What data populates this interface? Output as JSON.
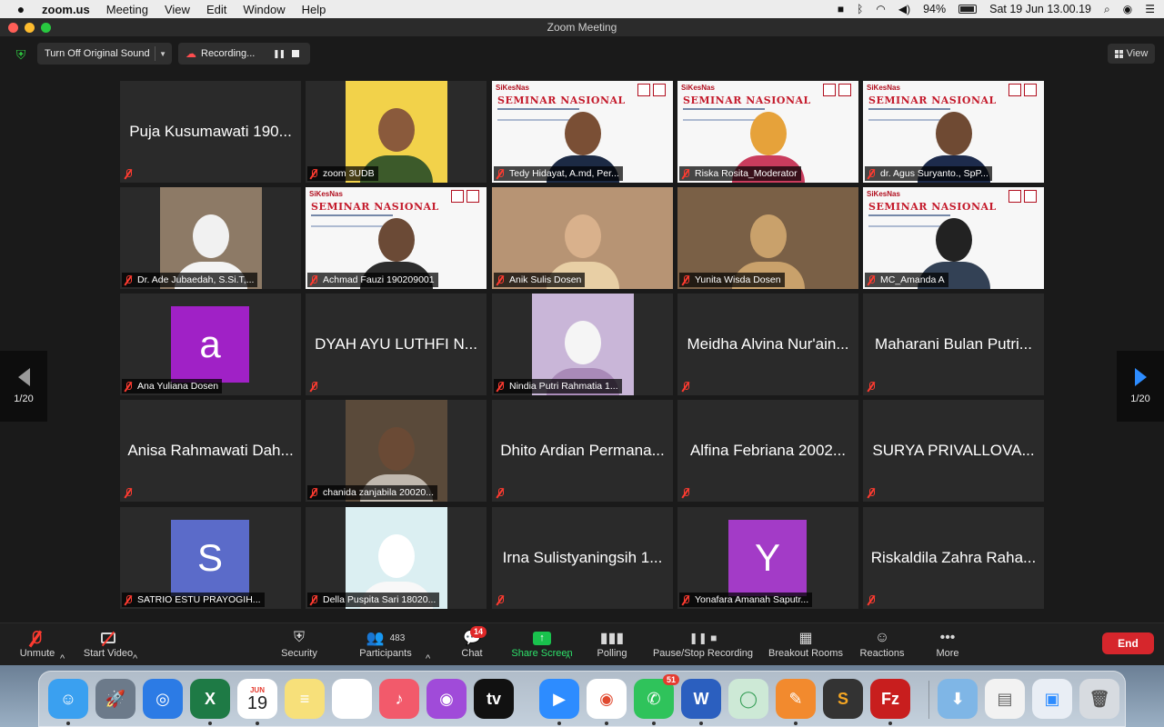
{
  "menubar": {
    "app_name": "zoom.us",
    "items": [
      "Meeting",
      "View",
      "Edit",
      "Window",
      "Help"
    ],
    "battery": "94%",
    "datetime": "Sat 19 Jun  13.00.19"
  },
  "window": {
    "title": "Zoom Meeting"
  },
  "topbar": {
    "original_sound_label": "Turn Off Original Sound",
    "recording_label": "Recording...",
    "view_label": "View"
  },
  "pagination": {
    "left": "1/20",
    "right": "1/20"
  },
  "tiles": [
    {
      "name": "Puja Kusumawati 190...",
      "type": "text"
    },
    {
      "name": "zoom 3UDB",
      "type": "video"
    },
    {
      "name": "Tedy Hidayat, A.md, Per...",
      "type": "video"
    },
    {
      "name": "Riska Rosita_Moderator",
      "type": "video",
      "active": true
    },
    {
      "name": "dr. Agus Suryanto., SpP...",
      "type": "video"
    },
    {
      "name": "Dr. Ade Jubaedah, S.Si.T,...",
      "type": "video"
    },
    {
      "name": "Achmad Fauzi 190209001",
      "type": "video"
    },
    {
      "name": "Anik Sulis Dosen",
      "type": "video"
    },
    {
      "name": "Yunita Wisda Dosen",
      "type": "video"
    },
    {
      "name": "MC_Amanda A",
      "type": "video"
    },
    {
      "name": "Ana Yuliana Dosen",
      "type": "avatar",
      "letter": "a",
      "color": "#a021c6"
    },
    {
      "name": "DYAH AYU LUTHFI N...",
      "type": "text"
    },
    {
      "name": "Nindia Putri Rahmatia 1...",
      "type": "video"
    },
    {
      "name": "Meidha Alvina Nur'ain...",
      "type": "text"
    },
    {
      "name": "Maharani Bulan Putri...",
      "type": "text"
    },
    {
      "name": "Anisa Rahmawati Dah...",
      "type": "text"
    },
    {
      "name": "chanida zanjabila 20020...",
      "type": "video"
    },
    {
      "name": "Dhito Ardian Permana...",
      "type": "text"
    },
    {
      "name": "Alfina Febriana 2002...",
      "type": "text"
    },
    {
      "name": "SURYA PRIVALLOVA...",
      "type": "text"
    },
    {
      "name": "SATRIO ESTU PRAYOGIH...",
      "type": "avatar",
      "letter": "S",
      "color": "#5b6bc9"
    },
    {
      "name": "Della Puspita Sari 18020...",
      "type": "video"
    },
    {
      "name": "Irna Sulistyaningsih 1...",
      "type": "text"
    },
    {
      "name": "Yonafara Amanah Saputr...",
      "type": "avatar",
      "letter": "Y",
      "color": "#a33bc7"
    },
    {
      "name": "Riskaldila Zahra Raha...",
      "type": "text"
    }
  ],
  "seminar": {
    "logo": "SiKesNas",
    "title": "SEMINAR NASIONAL"
  },
  "toolbar": {
    "unmute": "Unmute",
    "start_video": "Start Video",
    "security": "Security",
    "participants": "Participants",
    "participants_count": "483",
    "chat": "Chat",
    "chat_badge": "14",
    "share_screen": "Share Screen",
    "polling": "Polling",
    "pause_stop_recording": "Pause/Stop Recording",
    "breakout_rooms": "Breakout Rooms",
    "reactions": "Reactions",
    "more": "More",
    "end": "End"
  },
  "dock": {
    "calendar_month": "JUN",
    "calendar_day": "19",
    "whatsapp_badge": "51",
    "icons": [
      "finder-icon",
      "launchpad-icon",
      "safari-icon",
      "excel-icon",
      "calendar-icon",
      "notes-icon",
      "reminders-icon",
      "music-icon",
      "podcasts-icon",
      "apple-tv-icon",
      "zoom-icon",
      "chrome-icon",
      "whatsapp-icon",
      "word-icon",
      "anaconda-icon",
      "paw-icon",
      "sublime-icon",
      "filezilla-icon",
      "downloads-folder-icon",
      "document-stack-icon",
      "zoom-window-icon",
      "trash-icon"
    ]
  },
  "colors": {
    "accent_blue": "#2d8cff",
    "active_speaker": "#a7e35a",
    "end_red": "#d6262c",
    "share_green": "#2ee06a"
  }
}
